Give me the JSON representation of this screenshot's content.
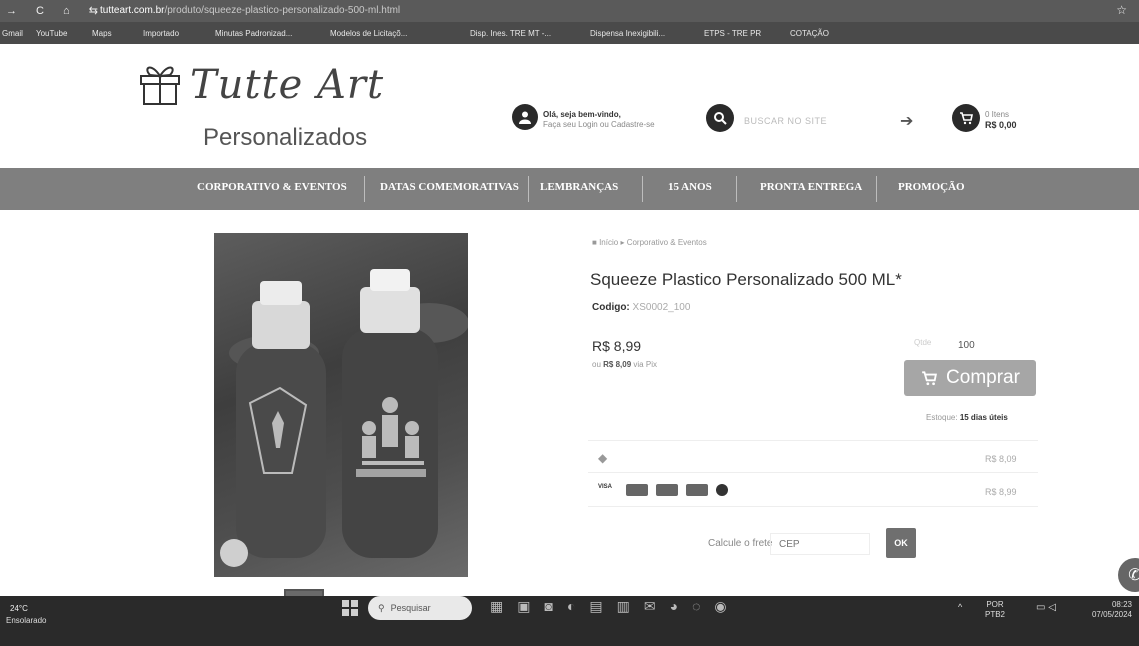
{
  "browser": {
    "url_host": "tutteart.com.br",
    "url_path": "/produto/squeeze-plastico-personalizado-500-ml.html",
    "nav_icons": "→ C ⌂ ⇆",
    "bookmarks": [
      "Gmail",
      "YouTube",
      "Maps",
      "Importado",
      "Minutas Padronizad...",
      "Modelos de Licitaçõ...",
      "Disp. Ines. TRE MT -...",
      "Dispensa Inexigibili...",
      "ETPS - TRE PR",
      "COTAÇÃO"
    ]
  },
  "header": {
    "logo_main": "Tutte Art",
    "logo_sub": "Personalizados",
    "login_line1": "Olá, seja bem-vindo,",
    "login_line2": "Faça seu Login ou Cadastre-se",
    "search_placeholder": "BUSCAR NO SITE",
    "cart_items": "0 Itens",
    "cart_total": "R$ 0,00"
  },
  "nav": {
    "items": [
      "CORPORATIVO & EVENTOS",
      "DATAS COMEMORATIVAS",
      "LEMBRANÇAS",
      "15 ANOS",
      "PRONTA ENTREGA",
      "PROMOÇÃO"
    ]
  },
  "product": {
    "breadcrumb_home": "Início",
    "breadcrumb_category": "Corporativo & Eventos",
    "title": "Squeeze Plastico Personalizado 500 ML*",
    "code_label": "Codigo:",
    "code_value": "XS0002_100",
    "price": "R$ 8,99",
    "price_pix_prefix": "ou",
    "price_pix_value": "R$ 8,09",
    "price_pix_suffix": "via Pix",
    "qty_label": "Qtde",
    "qty_value": "100",
    "buy_label": "Comprar",
    "stock_label": "Estoque:",
    "stock_value": "15 dias úteis",
    "pay_pix_amount": "R$ 8,09",
    "pay_card_amount": "R$ 8,99",
    "card_visa": "VISA",
    "freight_label": "Calcule o frete",
    "cep_placeholder": "CEP",
    "ok_label": "OK"
  },
  "taskbar": {
    "temp": "24°C",
    "weather": "Ensolarado",
    "search_placeholder": "Pesquisar",
    "lang1": "POR",
    "lang2": "PTB2",
    "time": "08:23",
    "date": "07/05/2024"
  },
  "colors": {
    "nav_bg": "#7f7f7f",
    "buy_button": "#a6a6a6",
    "ok_button": "#6f6f6f"
  }
}
